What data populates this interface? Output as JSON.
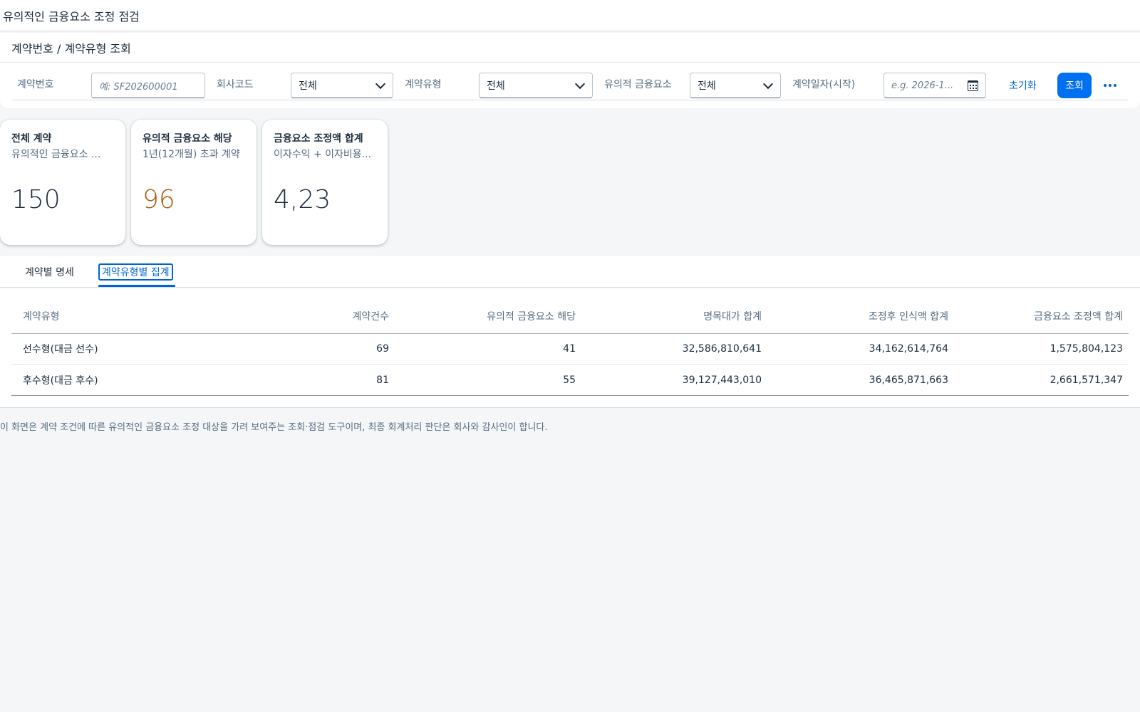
{
  "shell": {
    "title": "유의적인 금융요소 조정 점검"
  },
  "page": {
    "title": "계약번호 / 계약유형 조회"
  },
  "filters": {
    "contract_no": {
      "label": "계약번호",
      "placeholder": "예: SF202600001"
    },
    "company_code": {
      "label": "회사코드",
      "value": "전체"
    },
    "contract_type": {
      "label": "계약유형",
      "value": "전체"
    },
    "significant": {
      "label": "유의적 금융요소",
      "value": "전체"
    },
    "contract_date": {
      "label": "계약일자(시작)",
      "placeholder": "e.g. 2026-1..."
    },
    "reset_label": "초기화",
    "search_label": "조회"
  },
  "kpis": [
    {
      "title": "전체 계약",
      "subtitle": "유의적인 금융요소 ...",
      "value": "150",
      "color": "#1d2d3e"
    },
    {
      "title": "유의적 금융요소 해당",
      "subtitle": "1년(12개월) 초과 계약",
      "value": "96",
      "color": "#aa5808"
    },
    {
      "title": "금융요소 조정액 합계",
      "subtitle": "이자수익 + 이자비용...",
      "value": "4,23",
      "color": "#1d2d3e"
    }
  ],
  "tabs": [
    {
      "label": "계약별 명세"
    },
    {
      "label": "계약유형별 집계"
    }
  ],
  "table": {
    "headers": [
      "계약유형",
      "계약건수",
      "유의적 금융요소 해당",
      "명목대가 합계",
      "조정후 인식액 합계",
      "금융요소 조정액 합계"
    ],
    "rows": [
      [
        "선수형(대금 선수)",
        "69",
        "41",
        "32,586,810,641",
        "34,162,614,764",
        "1,575,804,123"
      ],
      [
        "후수형(대금 후수)",
        "81",
        "55",
        "39,127,443,010",
        "36,465,871,663",
        "2,661,571,347"
      ]
    ]
  },
  "footer": {
    "note": "이 화면은 계약 조건에 따른 유의적인 금융요소 조정 대상을 가려 보여주는 조회·점검 도구이며, 최종 회계처리 판단은 회사와 감사인이 합니다."
  }
}
